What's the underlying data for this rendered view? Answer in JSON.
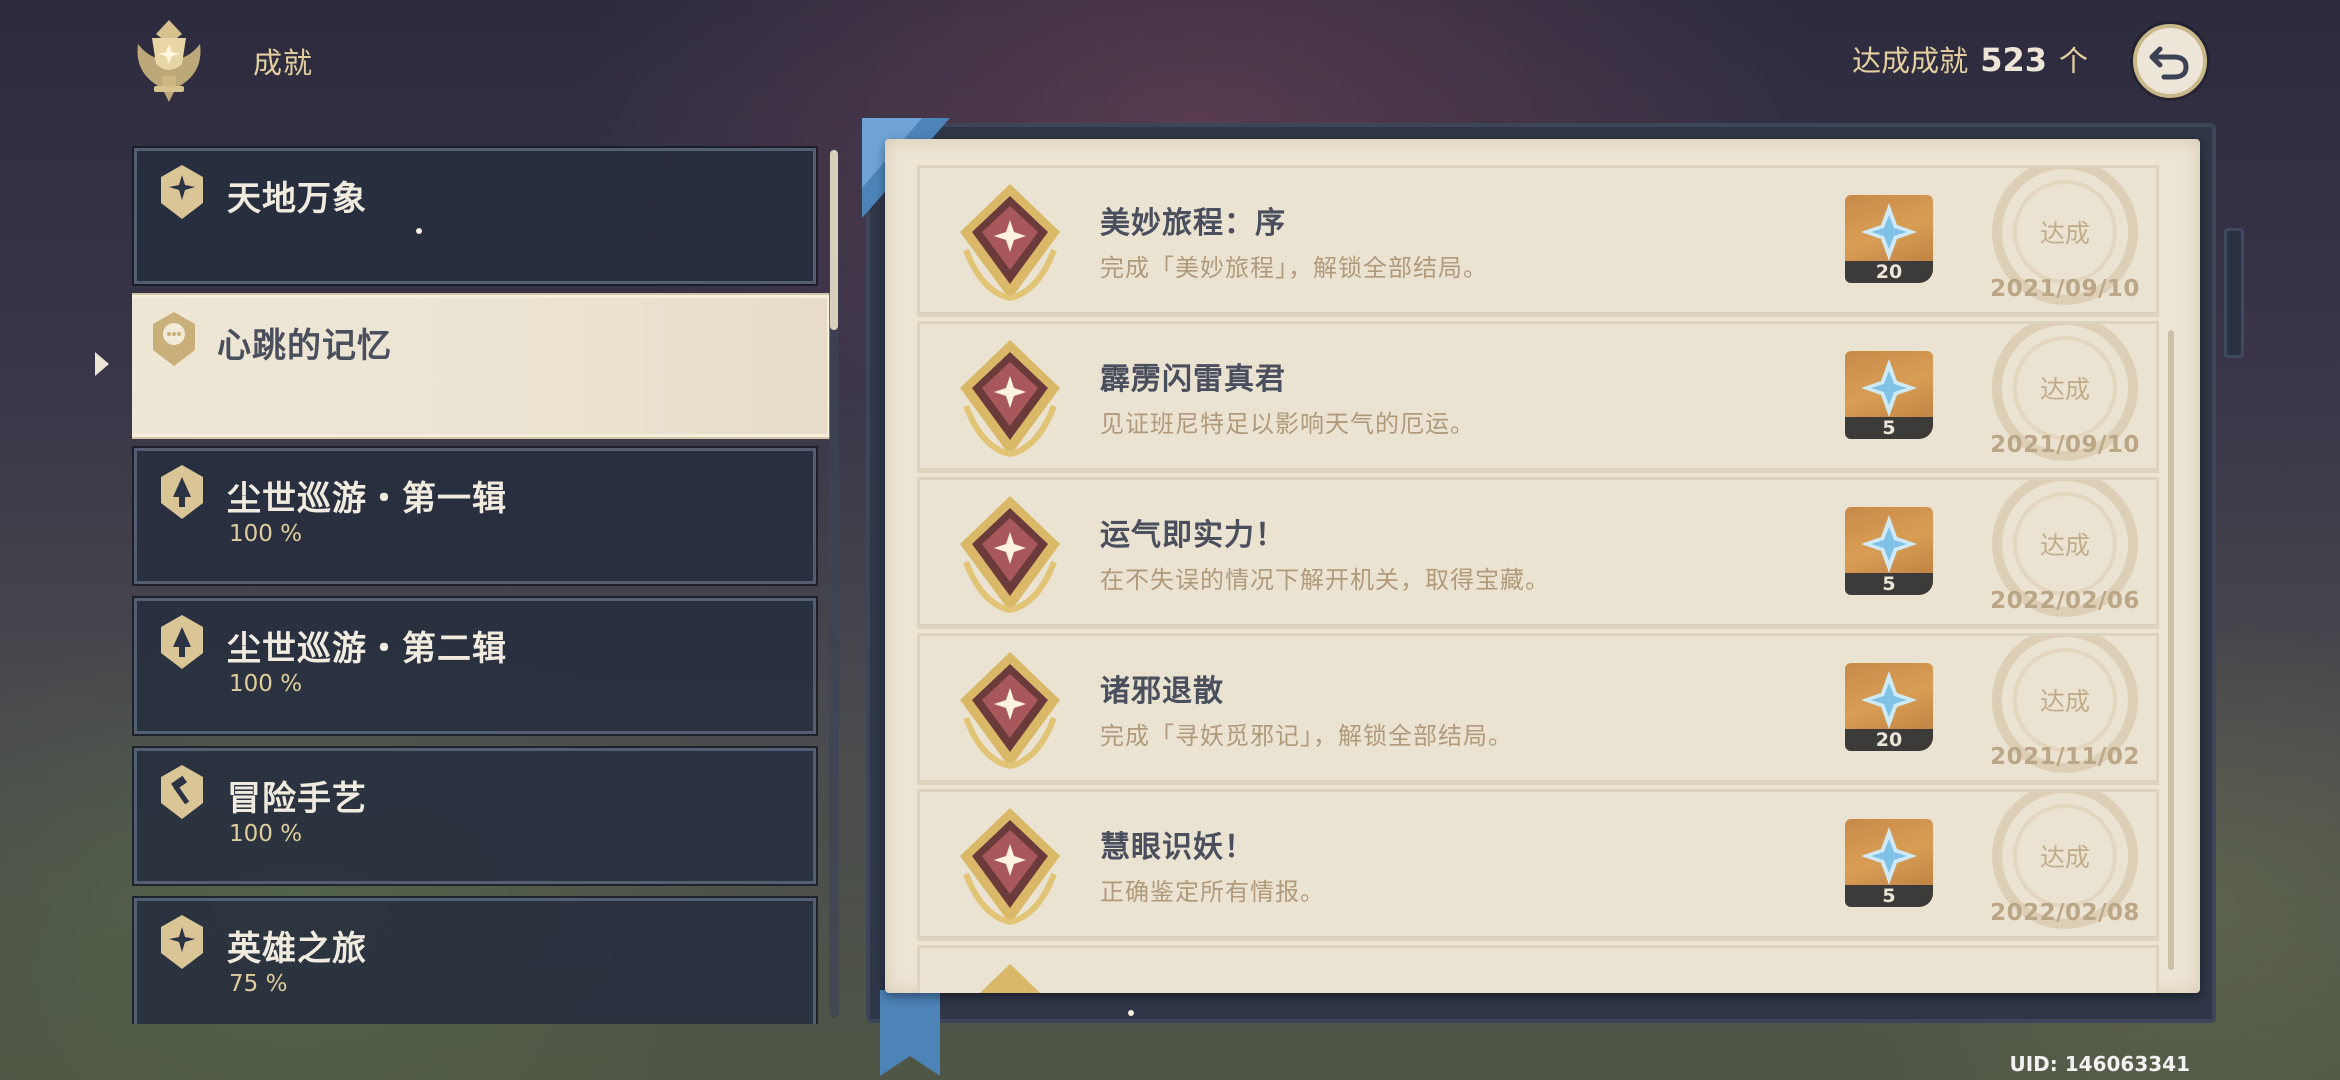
{
  "header": {
    "title": "成就",
    "count_label": "达成成就",
    "count_value": "523",
    "count_unit": "个"
  },
  "categories": [
    {
      "name": "天地万象",
      "progress": ""
    },
    {
      "name": "心跳的记忆",
      "progress": ""
    },
    {
      "name": "尘世巡游・第一辑",
      "progress": "100 %"
    },
    {
      "name": "尘世巡游・第二辑",
      "progress": "100 %"
    },
    {
      "name": "冒险手艺",
      "progress": "100 %"
    },
    {
      "name": "英雄之旅",
      "progress": "75 %"
    }
  ],
  "achievements": [
    {
      "title": "美妙旅程：序",
      "desc": "完成「美妙旅程」，解锁全部结局。",
      "reward_qty": "20",
      "status": "达成",
      "date": "2021/09/10"
    },
    {
      "title": "霹雳闪雷真君",
      "desc": "见证班尼特足以影响天气的厄运。",
      "reward_qty": "5",
      "status": "达成",
      "date": "2021/09/10"
    },
    {
      "title": "运气即实力！",
      "desc": "在不失误的情况下解开机关，取得宝藏。",
      "reward_qty": "5",
      "status": "达成",
      "date": "2022/02/06"
    },
    {
      "title": "诸邪退散",
      "desc": "完成「寻妖觅邪记」，解锁全部结局。",
      "reward_qty": "20",
      "status": "达成",
      "date": "2021/11/02"
    },
    {
      "title": "慧眼识妖！",
      "desc": "正确鉴定所有情报。",
      "reward_qty": "5",
      "status": "达成",
      "date": "2022/02/08"
    }
  ],
  "footer": {
    "uid": "UID: 146063341"
  },
  "colors": {
    "accent_gold": "#e3cf9f",
    "card_dark": "#262e3e",
    "page_cream": "#ede5d4",
    "text_dark": "#4a4f5e"
  },
  "icons": {
    "header": "trophy-emblem-icon",
    "back": "back-arrow-icon",
    "reward": "primogem-icon",
    "medal": "achievement-medal-icon"
  }
}
